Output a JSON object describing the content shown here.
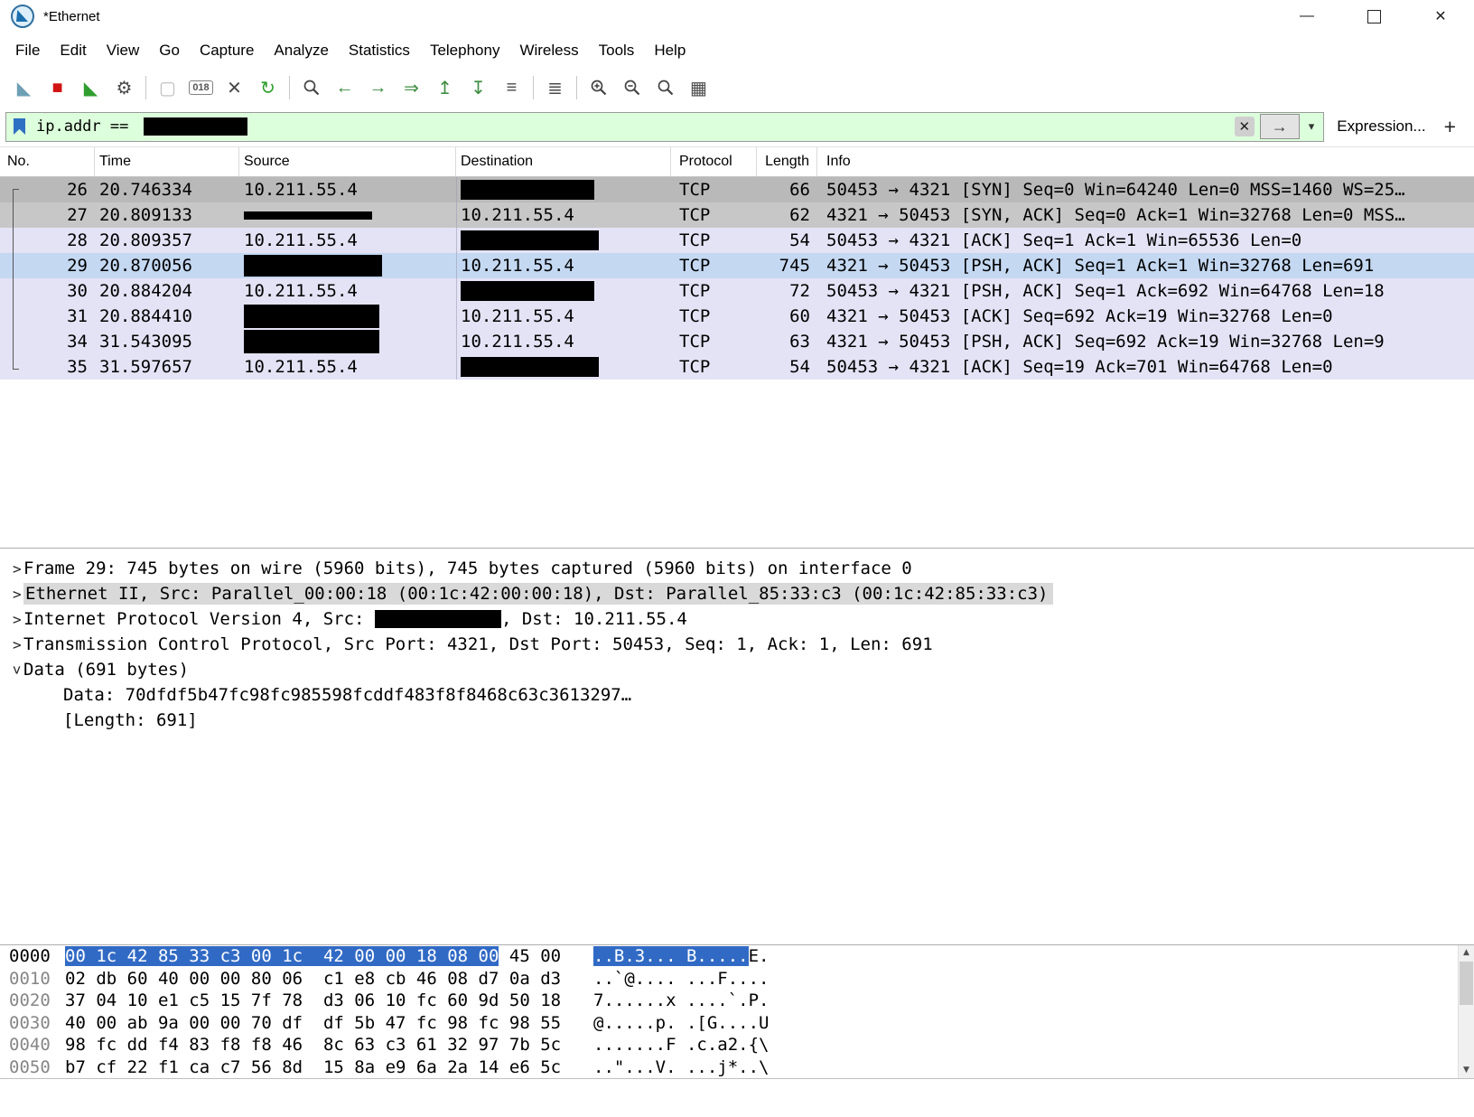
{
  "window": {
    "title": "*Ethernet",
    "minimize": "—",
    "close": "✕"
  },
  "menu": [
    "File",
    "Edit",
    "View",
    "Go",
    "Capture",
    "Analyze",
    "Statistics",
    "Telephony",
    "Wireless",
    "Tools",
    "Help"
  ],
  "toolbar": {
    "icons": [
      {
        "name": "start-capture",
        "glyph": "◣"
      },
      {
        "name": "stop-capture",
        "glyph": "■"
      },
      {
        "name": "restart-capture",
        "glyph": "◣"
      },
      {
        "name": "capture-options",
        "glyph": "⚙"
      },
      {
        "name": "open-file",
        "glyph": "▢"
      },
      {
        "name": "save-file",
        "glyph": "018"
      },
      {
        "name": "close-file",
        "glyph": "✕"
      },
      {
        "name": "reload",
        "glyph": "↻"
      },
      {
        "name": "find-packet",
        "glyph": ""
      },
      {
        "name": "go-back",
        "glyph": "←"
      },
      {
        "name": "go-forward",
        "glyph": "→"
      },
      {
        "name": "go-to-packet",
        "glyph": "⇒"
      },
      {
        "name": "go-first",
        "glyph": "↥"
      },
      {
        "name": "go-last",
        "glyph": "↧"
      },
      {
        "name": "auto-scroll",
        "glyph": "≡"
      },
      {
        "name": "colorize",
        "glyph": "≣"
      },
      {
        "name": "zoom-in",
        "glyph": ""
      },
      {
        "name": "zoom-out",
        "glyph": ""
      },
      {
        "name": "zoom-reset",
        "glyph": ""
      },
      {
        "name": "resize-columns",
        "glyph": "▦"
      }
    ]
  },
  "filter": {
    "value": "ip.addr == ",
    "value_redacted": true,
    "clear": "✕",
    "apply": "→",
    "dropdown": "▾",
    "expression": "Expression...",
    "add": "+"
  },
  "packet_list": {
    "columns": [
      "No.",
      "Time",
      "Source",
      "Destination",
      "Protocol",
      "Length",
      "Info"
    ],
    "rows": [
      {
        "no": "26",
        "time": "20.746334",
        "src": "10.211.55.4",
        "dst_redacted": true,
        "proto": "TCP",
        "len": "66",
        "info": "50453 → 4321 [SYN] Seq=0 Win=64240 Len=0 MSS=1460 WS=25…"
      },
      {
        "no": "27",
        "time": "20.809133",
        "src_redacted": true,
        "dst": "10.211.55.4",
        "proto": "TCP",
        "len": "62",
        "info": "4321 → 50453 [SYN, ACK] Seq=0 Ack=1 Win=32768 Len=0 MSS…"
      },
      {
        "no": "28",
        "time": "20.809357",
        "src": "10.211.55.4",
        "dst_redacted": true,
        "proto": "TCP",
        "len": "54",
        "info": "50453 → 4321 [ACK] Seq=1 Ack=1 Win=65536 Len=0"
      },
      {
        "no": "29",
        "time": "20.870056",
        "src_redacted": true,
        "dst": "10.211.55.4",
        "proto": "TCP",
        "len": "745",
        "info": "4321 → 50453 [PSH, ACK] Seq=1 Ack=1 Win=32768 Len=691"
      },
      {
        "no": "30",
        "time": "20.884204",
        "src": "10.211.55.4",
        "dst_redacted": true,
        "proto": "TCP",
        "len": "72",
        "info": "50453 → 4321 [PSH, ACK] Seq=1 Ack=692 Win=64768 Len=18"
      },
      {
        "no": "31",
        "time": "20.884410",
        "src_redacted": true,
        "dst": "10.211.55.4",
        "proto": "TCP",
        "len": "60",
        "info": "4321 → 50453 [ACK] Seq=692 Ack=19 Win=32768 Len=0"
      },
      {
        "no": "34",
        "time": "31.543095",
        "src_redacted": true,
        "dst": "10.211.55.4",
        "proto": "TCP",
        "len": "63",
        "info": "4321 → 50453 [PSH, ACK] Seq=692 Ack=19 Win=32768 Len=9"
      },
      {
        "no": "35",
        "time": "31.597657",
        "src": "10.211.55.4",
        "dst_redacted": true,
        "proto": "TCP",
        "len": "54",
        "info": "50453 → 4321 [ACK] Seq=19 Ack=701 Win=64768 Len=0"
      }
    ]
  },
  "details": {
    "lines": [
      {
        "expander": ">",
        "text": "Frame 29: 745 bytes on wire (5960 bits), 745 bytes captured (5960 bits) on interface 0"
      },
      {
        "expander": ">",
        "text": "Ethernet II, Src: Parallel_00:00:18 (00:1c:42:00:00:18), Dst: Parallel_85:33:c3 (00:1c:42:85:33:c3)",
        "selected": true
      },
      {
        "expander": ">",
        "prefix": "Internet Protocol Version 4, Src: ",
        "redacted": true,
        "suffix": ", Dst: 10.211.55.4"
      },
      {
        "expander": ">",
        "text": "Transmission Control Protocol, Src Port: 4321, Dst Port: 50453, Seq: 1, Ack: 1, Len: 691"
      },
      {
        "expander": ">",
        "expanded": true,
        "text": "Data (691 bytes)"
      },
      {
        "text": "Data: 70dfdf5b47fc98fc985598fcddf483f8f8468c63c3613297…",
        "indent": 2
      },
      {
        "text": "[Length: 691]",
        "indent": 2
      }
    ]
  },
  "hex": {
    "rows": [
      {
        "offset": "0000",
        "hex_hl": "00 1c 42 85 33 c3 00 1c  42 00 00 18 08 00",
        "hex_rest": " 45 00",
        "ascii_hl": "..B.3... B.....",
        "ascii_rest": "E."
      },
      {
        "offset": "0010",
        "hex_hl": "",
        "hex_rest": "02 db 60 40 00 00 80 06  c1 e8 cb 46 08 d7 0a d3",
        "ascii_hl": "",
        "ascii_rest": "..`@.... ...F...."
      },
      {
        "offset": "0020",
        "hex_hl": "",
        "hex_rest": "37 04 10 e1 c5 15 7f 78  d3 06 10 fc 60 9d 50 18",
        "ascii_hl": "",
        "ascii_rest": "7......x ....`.P."
      },
      {
        "offset": "0030",
        "hex_hl": "",
        "hex_rest": "40 00 ab 9a 00 00 70 df  df 5b 47 fc 98 fc 98 55",
        "ascii_hl": "",
        "ascii_rest": "@.....p. .[G....U"
      },
      {
        "offset": "0040",
        "hex_hl": "",
        "hex_rest": "98 fc dd f4 83 f8 f8 46  8c 63 c3 61 32 97 7b 5c",
        "ascii_hl": "",
        "ascii_rest": ".......F .c.a2.{\\"
      },
      {
        "offset": "0050",
        "hex_hl": "",
        "hex_rest": "b7 cf 22 f1 ca c7 56 8d  15 8a e9 6a 2a 14 e6 5c",
        "ascii_hl": "",
        "ascii_rest": "..\"...V. ...j*..\\"
      }
    ]
  },
  "scrollbar": {
    "up": "▲",
    "down": "▼"
  }
}
